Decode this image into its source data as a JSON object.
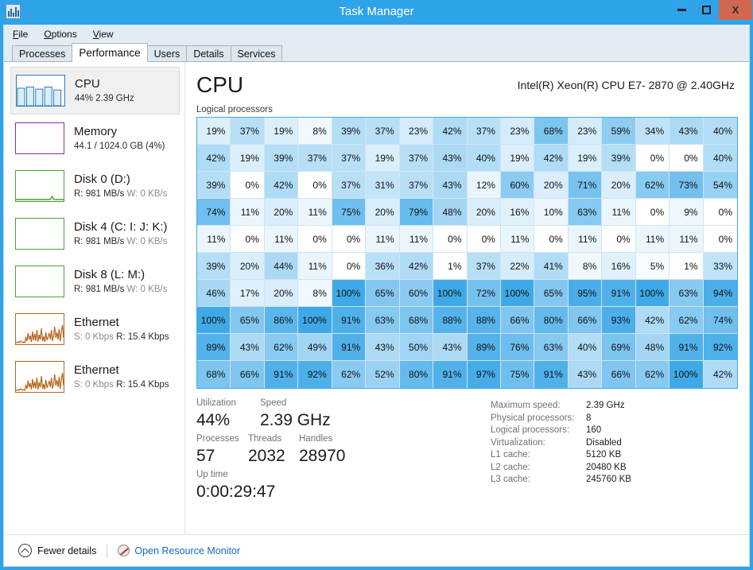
{
  "window": {
    "title": "Task Manager",
    "icon": "task-manager-icon",
    "buttons": {
      "minimize": "minimize-icon",
      "maximize": "maximize-icon",
      "close": "X"
    },
    "close_color": "#d2674f",
    "titlebar_color": "#2ea3e8"
  },
  "menu": [
    {
      "label": "File",
      "accel": "F"
    },
    {
      "label": "Options",
      "accel": "O"
    },
    {
      "label": "View",
      "accel": "V"
    }
  ],
  "tabs": [
    {
      "label": "Processes",
      "active": false
    },
    {
      "label": "Performance",
      "active": true
    },
    {
      "label": "Users",
      "active": false
    },
    {
      "label": "Details",
      "active": false
    },
    {
      "label": "Services",
      "active": false
    }
  ],
  "sidebar": {
    "items": [
      {
        "title": "CPU",
        "sub": "44%  2.39 GHz",
        "sub_dim": "",
        "graph": "cpu-bars",
        "color": "#2b7cb8",
        "selected": true
      },
      {
        "title": "Memory",
        "sub": "44.1 / 1024.0 GB (4%)",
        "sub_dim": "",
        "graph": "empty",
        "color": "#8b2fa5",
        "selected": false
      },
      {
        "title": "Disk 0 (D:)",
        "sub": "R: 981 MB/s  W: 0 KB/s",
        "sub_dim": "W",
        "graph": "disk-flat",
        "color": "#4aa12e",
        "selected": false
      },
      {
        "title": "Disk 4 (C: I: J: K:)",
        "sub": "R: 981 MB/s  W: 0 KB/s",
        "sub_dim": "W",
        "graph": "empty",
        "color": "#4aa12e",
        "selected": false
      },
      {
        "title": "Disk 8 (L: M:)",
        "sub": "R: 981 MB/s  W: 0 KB/s",
        "sub_dim": "W",
        "graph": "empty",
        "color": "#4aa12e",
        "selected": false
      },
      {
        "title": "Ethernet",
        "sub": "S: 0 Kbps  R: 15.4 Kbps",
        "sub_dim": "S",
        "graph": "net-spiky",
        "color": "#b5651d",
        "selected": false
      },
      {
        "title": "Ethernet",
        "sub": "S: 0 Kbps  R: 15.4 Kbps",
        "sub_dim": "S",
        "graph": "net-spiky",
        "color": "#b5651d",
        "selected": false
      }
    ]
  },
  "main": {
    "heading": "CPU",
    "model": "Intel(R) Xeon(R) CPU E7- 2870  @ 2.40GHz",
    "grid_label": "Logical processors",
    "grid_accent": "#3fa9e8"
  },
  "chart_data": {
    "type": "heatmap",
    "title": "Logical processors",
    "unit": "%",
    "columns": 16,
    "rows": 10,
    "vmin": 0,
    "vmax": 100,
    "colormap": [
      "#ffffff",
      "#3fa9e8"
    ],
    "values": [
      [
        19,
        37,
        19,
        8,
        39,
        37,
        23,
        42,
        37,
        23,
        68,
        23,
        59,
        34,
        43,
        40
      ],
      [
        42,
        19,
        39,
        37,
        37,
        19,
        37,
        43,
        40,
        19,
        42,
        19,
        39,
        0,
        0,
        40
      ],
      [
        39,
        0,
        42,
        0,
        37,
        31,
        37,
        43,
        12,
        60,
        20,
        71,
        20,
        62,
        73,
        54
      ],
      [
        74,
        11,
        20,
        11,
        75,
        20,
        79,
        48,
        20,
        16,
        10,
        63,
        11,
        0,
        9,
        0
      ],
      [
        11,
        0,
        11,
        0,
        0,
        11,
        11,
        0,
        0,
        11,
        0,
        11,
        0,
        11,
        11,
        0
      ],
      [
        39,
        20,
        44,
        11,
        0,
        36,
        42,
        1,
        37,
        22,
        41,
        8,
        16,
        5,
        1,
        33
      ],
      [
        46,
        17,
        20,
        8,
        100,
        65,
        60,
        100,
        72,
        100,
        65,
        95,
        91,
        100,
        63,
        94
      ],
      [
        100,
        65,
        86,
        100,
        91,
        63,
        68,
        88,
        88,
        66,
        80,
        66,
        93,
        42,
        62,
        74
      ],
      [
        89,
        43,
        62,
        49,
        91,
        43,
        50,
        43,
        89,
        76,
        63,
        40,
        69,
        48,
        91,
        92
      ],
      [
        68,
        66,
        91,
        92,
        62,
        52,
        80,
        91,
        97,
        75,
        91,
        43,
        66,
        62,
        100,
        42
      ]
    ]
  },
  "stats": {
    "utilization_label": "Utilization",
    "utilization_value": "44%",
    "speed_label": "Speed",
    "speed_value": "2.39 GHz",
    "processes_label": "Processes",
    "processes_value": "57",
    "threads_label": "Threads",
    "threads_value": "2032",
    "handles_label": "Handles",
    "handles_value": "28970",
    "uptime_label": "Up time",
    "uptime_value": "0:00:29:47"
  },
  "info": [
    {
      "label": "Maximum speed:",
      "value": "2.39 GHz"
    },
    {
      "label": "Physical processors:",
      "value": "8"
    },
    {
      "label": "Logical processors:",
      "value": "160"
    },
    {
      "label": "Virtualization:",
      "value": "Disabled"
    },
    {
      "label": "L1 cache:",
      "value": "5120 KB"
    },
    {
      "label": "L2 cache:",
      "value": "20480 KB"
    },
    {
      "label": "L3 cache:",
      "value": "245760 KB"
    }
  ],
  "footer": {
    "fewer_details": "Fewer details",
    "resource_monitor": "Open Resource Monitor",
    "link_color": "#1567c8"
  }
}
